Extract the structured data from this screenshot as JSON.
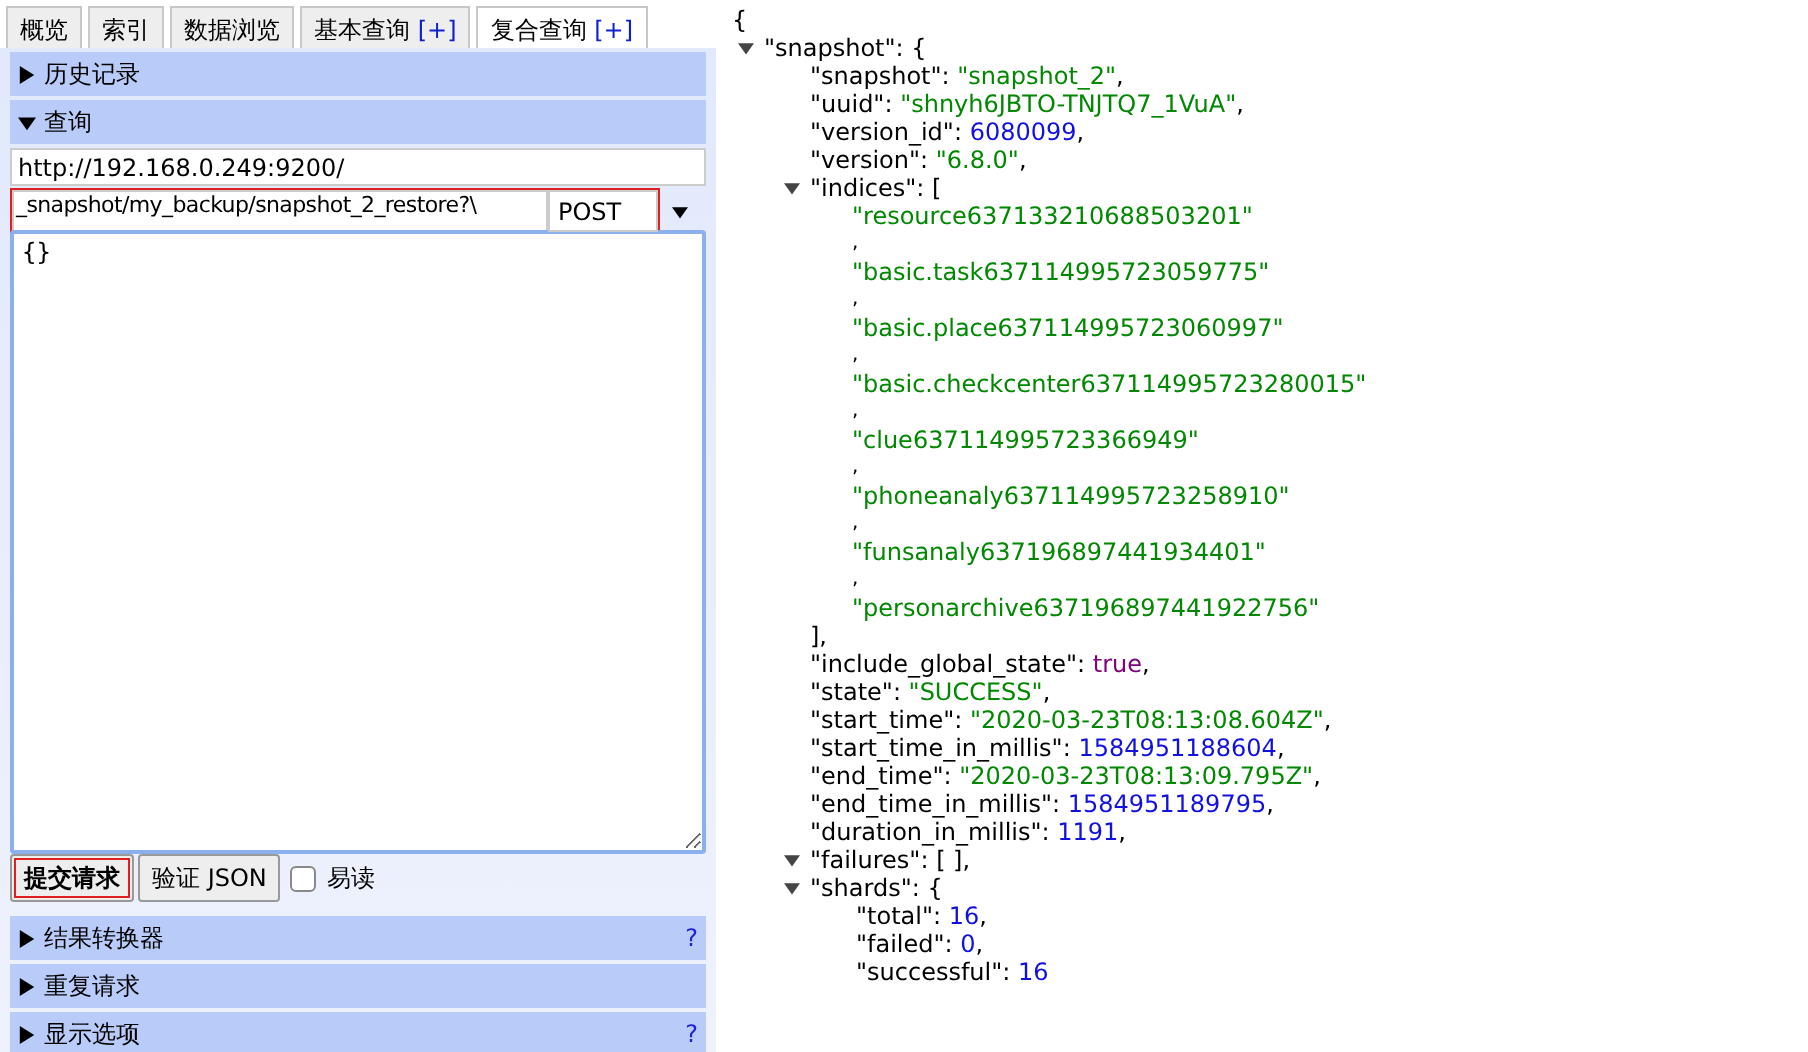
{
  "tabs": [
    {
      "label": "概览",
      "selected": false
    },
    {
      "label": "索引",
      "selected": false
    },
    {
      "label": "数据浏览",
      "selected": false
    },
    {
      "label": "基本查询",
      "extra": "[+]",
      "selected": false
    },
    {
      "label": "复合查询",
      "extra": "[+]",
      "selected": true
    }
  ],
  "sections": [
    {
      "title": "历史记录",
      "expanded": false
    },
    {
      "title": "查询",
      "expanded": true,
      "kind": "query"
    },
    {
      "title": "结果转换器",
      "expanded": false,
      "help": "?"
    },
    {
      "title": "重复请求",
      "expanded": false
    },
    {
      "title": "显示选项",
      "expanded": false,
      "help": "?"
    }
  ],
  "query": {
    "url": "http://192.168.0.249:9200/",
    "path": "_snapshot/my_backup/snapshot_2_restore?\\",
    "method": "POST",
    "request_highlighted": true,
    "body": "{}",
    "buttons": [
      {
        "label": "提交请求",
        "kind": "submit",
        "highlighted": true
      },
      {
        "label": "验证 JSON",
        "kind": "validate",
        "highlighted": false
      }
    ],
    "pretty": {
      "label": "易读",
      "checked": false
    }
  },
  "output": {
    "open": "{",
    "children": [
      {
        "key": "\"snapshot\": ",
        "kind": "object",
        "open": "{",
        "expanded": true,
        "children": [
          {
            "key": "\"snapshot\": ",
            "kind": "string",
            "value": "\"snapshot_2\"",
            "end": ","
          },
          {
            "key": "\"uuid\": ",
            "kind": "string",
            "value": "\"shnyh6JBTO-TNJTQ7_1VuA\"",
            "end": ","
          },
          {
            "key": "\"version_id\": ",
            "kind": "number",
            "value": "6080099",
            "end": ","
          },
          {
            "key": "\"version\": ",
            "kind": "string",
            "value": "\"6.8.0\"",
            "end": ","
          },
          {
            "key": "\"indices\": ",
            "kind": "array",
            "open": "[",
            "expanded": true,
            "close": "],",
            "children": [
              {
                "kind": "string",
                "value": "\"resource637133210688503201\"",
                "end": ","
              },
              {
                "kind": "string",
                "value": "\"basic.task637114995723059775\"",
                "end": ","
              },
              {
                "kind": "string",
                "value": "\"basic.place637114995723060997\"",
                "end": ","
              },
              {
                "kind": "string",
                "value": "\"basic.checkcenter637114995723280015\"",
                "end": ","
              },
              {
                "kind": "string",
                "value": "\"clue637114995723366949\"",
                "end": ","
              },
              {
                "kind": "string",
                "value": "\"phoneanaly637114995723258910\"",
                "end": ","
              },
              {
                "kind": "string",
                "value": "\"funsanaly637196897441934401\"",
                "end": ","
              },
              {
                "kind": "string",
                "value": "\"personarchive637196897441922756\""
              }
            ]
          },
          {
            "key": "\"include_global_state\": ",
            "kind": "boolean",
            "value": "true",
            "end": ","
          },
          {
            "key": "\"state\": ",
            "kind": "string",
            "value": "\"SUCCESS\"",
            "end": ","
          },
          {
            "key": "\"start_time\": ",
            "kind": "string",
            "value": "\"2020-03-23T08:13:08.604Z\"",
            "end": ","
          },
          {
            "key": "\"start_time_in_millis\": ",
            "kind": "number",
            "value": "1584951188604",
            "end": ","
          },
          {
            "key": "\"end_time\": ",
            "kind": "string",
            "value": "\"2020-03-23T08:13:09.795Z\"",
            "end": ","
          },
          {
            "key": "\"end_time_in_millis\": ",
            "kind": "number",
            "value": "1584951189795",
            "end": ","
          },
          {
            "key": "\"duration_in_millis\": ",
            "kind": "number",
            "value": "1191",
            "end": ","
          },
          {
            "key": "\"failures\": ",
            "kind": "array",
            "open": "[ ],",
            "expanded": true
          },
          {
            "key": "\"shards\": ",
            "kind": "object",
            "open": "{",
            "expanded": true,
            "children": [
              {
                "key": "\"total\": ",
                "kind": "number",
                "value": "16",
                "end": ","
              },
              {
                "key": "\"failed\": ",
                "kind": "number",
                "value": "0",
                "end": ","
              },
              {
                "key": "\"successful\": ",
                "kind": "number",
                "value": "16"
              }
            ]
          }
        ]
      }
    ]
  }
}
